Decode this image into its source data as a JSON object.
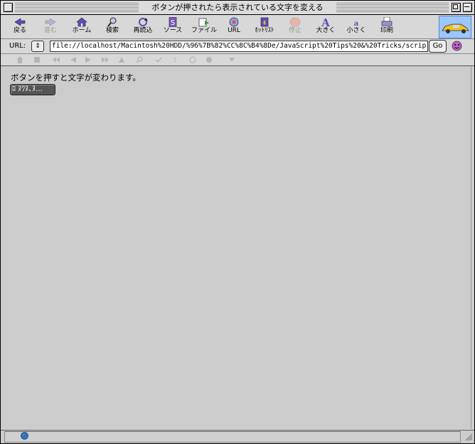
{
  "window": {
    "title": "ボタンが押されたら表示されている文字を変える"
  },
  "toolbar": {
    "buttons": [
      {
        "label": "戻る",
        "icon": "back-arrow-icon",
        "enabled": true
      },
      {
        "label": "進む",
        "icon": "forward-arrow-icon",
        "enabled": false
      },
      {
        "label": "ホーム",
        "icon": "home-icon",
        "enabled": true
      },
      {
        "label": "検索",
        "icon": "search-icon",
        "enabled": true
      },
      {
        "label": "再読込",
        "icon": "reload-icon",
        "enabled": true
      },
      {
        "label": "ソース",
        "icon": "source-icon",
        "enabled": true
      },
      {
        "label": "ファイル",
        "icon": "file-icon",
        "enabled": true
      },
      {
        "label": "URL",
        "icon": "url-icon",
        "enabled": true
      },
      {
        "label": "ﾎｯﾄﾘｽﾄ",
        "icon": "hotlist-icon",
        "enabled": true
      },
      {
        "label": "停止",
        "icon": "stop-icon",
        "enabled": false
      },
      {
        "label": "大きく",
        "icon": "font-larger-icon",
        "enabled": true
      },
      {
        "label": "小さく",
        "icon": "font-smaller-icon",
        "enabled": true
      },
      {
        "label": "印刷",
        "icon": "print-icon",
        "enabled": true
      }
    ]
  },
  "urlbar": {
    "label": "URL:",
    "popup": "⇕",
    "value": "file://localhost/Macintosh%20HDD/%96%7B%82%CC%8C%B4%8De/JavaScript%20Tips%20&%20Tricks/scrip",
    "go_label": "Go"
  },
  "content": {
    "message": "ボタンを押すと文字が変わります。",
    "button_label": "ﾛ ﾇﾜﾇ､ﾇ..."
  },
  "colors": {
    "background": "#cccccc",
    "button_bg": "#555555",
    "logo_bg": "#9cc6ff"
  }
}
